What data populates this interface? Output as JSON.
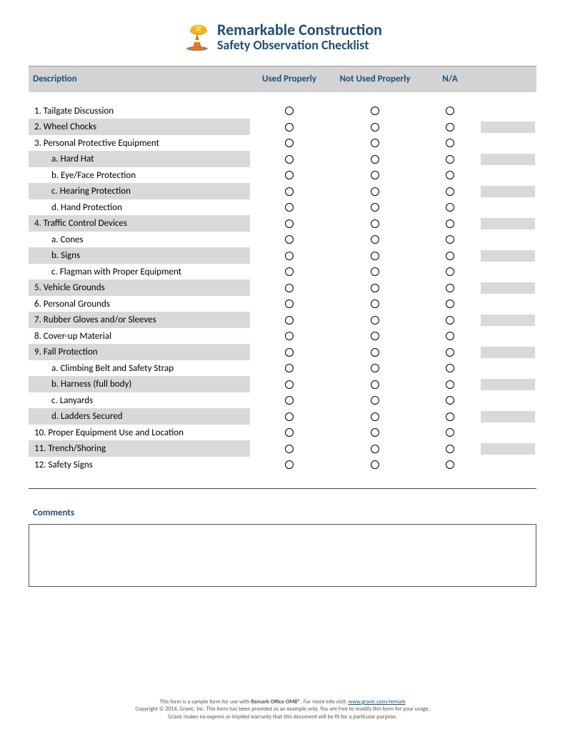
{
  "header": {
    "company": "Remarkable Construction",
    "subtitle": "Safety Observation Checklist"
  },
  "columns": {
    "description": "Description",
    "used": "Used Properly",
    "not_used": "Not Used Properly",
    "na": "N/A"
  },
  "rows": [
    {
      "label": "1. Tailgate Discussion",
      "sub": false,
      "shade": false,
      "extra": false
    },
    {
      "label": "2. Wheel Chocks",
      "sub": false,
      "shade": true,
      "extra": true
    },
    {
      "label": "3. Personal Protective Equipment",
      "sub": false,
      "shade": false,
      "extra": false
    },
    {
      "label": "a. Hard Hat",
      "sub": true,
      "shade": true,
      "extra": true
    },
    {
      "label": "b. Eye/Face Protection",
      "sub": true,
      "shade": false,
      "extra": false
    },
    {
      "label": "c. Hearing Protection",
      "sub": true,
      "shade": true,
      "extra": true
    },
    {
      "label": "d. Hand Protection",
      "sub": true,
      "shade": false,
      "extra": false
    },
    {
      "label": "4. Traffic Control Devices",
      "sub": false,
      "shade": true,
      "extra": true
    },
    {
      "label": "a. Cones",
      "sub": true,
      "shade": false,
      "extra": false
    },
    {
      "label": "b. Signs",
      "sub": true,
      "shade": true,
      "extra": true
    },
    {
      "label": "c. Flagman with Proper Equipment",
      "sub": true,
      "shade": false,
      "extra": false
    },
    {
      "label": "5. Vehicle Grounds",
      "sub": false,
      "shade": true,
      "extra": true
    },
    {
      "label": "6. Personal Grounds",
      "sub": false,
      "shade": false,
      "extra": false
    },
    {
      "label": "7. Rubber Gloves and/or Sleeves",
      "sub": false,
      "shade": true,
      "extra": true
    },
    {
      "label": "8. Cover-up Material",
      "sub": false,
      "shade": false,
      "extra": false
    },
    {
      "label": "9. Fall Protection",
      "sub": false,
      "shade": true,
      "extra": true
    },
    {
      "label": "a. Climbing Belt and Safety Strap",
      "sub": true,
      "shade": false,
      "extra": false
    },
    {
      "label": "b. Harness (full body)",
      "sub": true,
      "shade": true,
      "extra": true
    },
    {
      "label": "c. Lanyards",
      "sub": true,
      "shade": false,
      "extra": false
    },
    {
      "label": "d. Ladders Secured",
      "sub": true,
      "shade": true,
      "extra": true
    },
    {
      "label": "10. Proper Equipment Use and Location",
      "sub": false,
      "shade": false,
      "extra": false
    },
    {
      "label": "11. Trench/Shoring",
      "sub": false,
      "shade": true,
      "extra": true
    },
    {
      "label": "12. Safety Signs",
      "sub": false,
      "shade": false,
      "extra": false
    }
  ],
  "comments_label": "Comments",
  "footer": {
    "line1a": "This form is a sample form for use with ",
    "line1b": "Remark Office OMR®.",
    "line1c": " For more info visit: ",
    "link": "www.gravic.com/remark",
    "line2": "Copyright © 2014, Gravic, Inc. This form has been provided as an example only. You are free to modify this form for your usage.",
    "line3": "Gravic makes no express or implied warranty that this document will be fit for a particular purpose."
  }
}
